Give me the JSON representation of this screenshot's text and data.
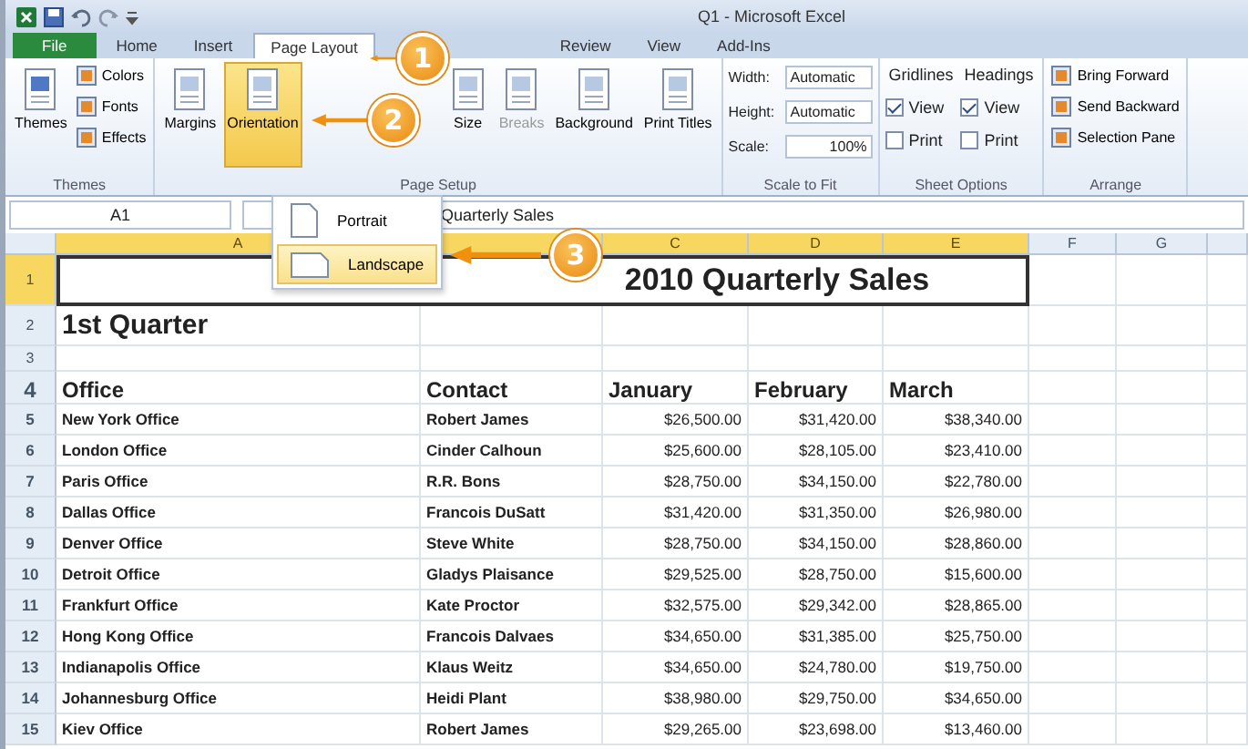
{
  "window": {
    "title": "Q1 - Microsoft Excel"
  },
  "tabs": [
    {
      "label": "File",
      "kind": "file",
      "selected": false
    },
    {
      "label": "Home",
      "kind": "tab",
      "selected": false
    },
    {
      "label": "Insert",
      "kind": "tab",
      "selected": false
    },
    {
      "label": "Page Layout",
      "kind": "tab",
      "selected": true
    },
    {
      "label": "Review",
      "kind": "tab",
      "selected": false
    },
    {
      "label": "View",
      "kind": "tab",
      "selected": false
    },
    {
      "label": "Add-Ins",
      "kind": "tab",
      "selected": false
    }
  ],
  "ribbon": {
    "groups": [
      {
        "label": "Themes",
        "columns": [
          [
            {
              "kind": "large",
              "label": "Themes",
              "selected": false,
              "disabled": false
            }
          ],
          [
            {
              "kind": "small",
              "label": "Colors"
            },
            {
              "kind": "small",
              "label": "Fonts"
            },
            {
              "kind": "small",
              "label": "Effects"
            }
          ]
        ]
      },
      {
        "label": "Page Setup",
        "columns": [
          [
            {
              "kind": "large",
              "label": "Margins",
              "selected": false,
              "disabled": false
            }
          ],
          [
            {
              "kind": "large",
              "label": "Orientation",
              "selected": true,
              "disabled": false
            }
          ],
          [
            {
              "kind": "large",
              "label": "Size",
              "selected": false,
              "disabled": false
            }
          ],
          [
            {
              "kind": "large",
              "label": "Breaks",
              "selected": false,
              "disabled": true
            }
          ],
          [
            {
              "kind": "large",
              "label": "Background",
              "selected": false,
              "disabled": false
            }
          ],
          [
            {
              "kind": "large",
              "label": "Print Titles",
              "selected": false,
              "disabled": false
            }
          ]
        ]
      },
      {
        "label": "Scale to Fit",
        "columns": [
          [
            {
              "kind": "dropdown",
              "label": "Width:",
              "value": "Automatic"
            },
            {
              "kind": "dropdown",
              "label": "Height:",
              "value": "Automatic"
            },
            {
              "kind": "spinner",
              "label": "Scale:",
              "value": "100%"
            }
          ]
        ]
      },
      {
        "label": "Sheet Options",
        "columns": [
          [
            {
              "kind": "heading",
              "label": "Gridlines"
            },
            {
              "kind": "check",
              "label": "View",
              "checked": true
            },
            {
              "kind": "check",
              "label": "Print",
              "checked": false
            }
          ],
          [
            {
              "kind": "heading",
              "label": "Headings"
            },
            {
              "kind": "check",
              "label": "View",
              "checked": true
            },
            {
              "kind": "check",
              "label": "Print",
              "checked": false
            }
          ]
        ]
      },
      {
        "label": "Arrange",
        "columns": [
          [
            {
              "kind": "small",
              "label": "Bring Forward"
            },
            {
              "kind": "small",
              "label": "Send Backward"
            },
            {
              "kind": "small",
              "label": "Selection Pane"
            }
          ]
        ]
      }
    ]
  },
  "orientation_menu": [
    {
      "label": "Portrait",
      "selected": false
    },
    {
      "label": "Landscape",
      "selected": true
    }
  ],
  "formula_bar": {
    "name_box": "A1",
    "formula": "Quarterly Sales"
  },
  "columns": [
    {
      "label": "A",
      "selected": true
    },
    {
      "selected": true
    },
    {
      "label": "C",
      "selected": true
    },
    {
      "label": "D",
      "selected": true
    },
    {
      "label": "E",
      "selected": true
    },
    {
      "label": "F",
      "selected": false
    },
    {
      "label": "G",
      "selected": false
    }
  ],
  "rows": [
    {
      "number": "1",
      "kind": "title",
      "selected": true,
      "cells": [
        "2010 Quarterly Sales"
      ]
    },
    {
      "number": "2",
      "kind": "subtitle",
      "selected": false,
      "cells": [
        "1st Quarter"
      ]
    },
    {
      "number": "3",
      "kind": "blank",
      "selected": false,
      "cells": []
    },
    {
      "number": "4",
      "kind": "header",
      "selected": false,
      "cells": [
        "Office",
        "Contact",
        "January",
        "February",
        "March"
      ]
    },
    {
      "number": "5",
      "kind": "data",
      "selected": false,
      "cells": [
        "New York Office",
        "Robert James",
        "$26,500.00",
        "$31,420.00",
        "$38,340.00"
      ]
    },
    {
      "number": "6",
      "kind": "data",
      "selected": false,
      "cells": [
        "London Office",
        "Cinder Calhoun",
        "$25,600.00",
        "$28,105.00",
        "$23,410.00"
      ]
    },
    {
      "number": "7",
      "kind": "data",
      "selected": false,
      "cells": [
        "Paris Office",
        "R.R. Bons",
        "$28,750.00",
        "$34,150.00",
        "$22,780.00"
      ]
    },
    {
      "number": "8",
      "kind": "data",
      "selected": false,
      "cells": [
        "Dallas Office",
        "Francois DuSatt",
        "$31,420.00",
        "$31,350.00",
        "$26,980.00"
      ]
    },
    {
      "number": "9",
      "kind": "data",
      "selected": false,
      "cells": [
        "Denver Office",
        "Steve White",
        "$28,750.00",
        "$34,150.00",
        "$28,860.00"
      ]
    },
    {
      "number": "10",
      "kind": "data",
      "selected": false,
      "cells": [
        "Detroit Office",
        "Gladys Plaisance",
        "$29,525.00",
        "$28,750.00",
        "$15,600.00"
      ]
    },
    {
      "number": "11",
      "kind": "data",
      "selected": false,
      "cells": [
        "Frankfurt Office",
        "Kate Proctor",
        "$32,575.00",
        "$29,342.00",
        "$28,865.00"
      ]
    },
    {
      "number": "12",
      "kind": "data",
      "selected": false,
      "cells": [
        "Hong Kong Office",
        "Francois Dalvaes",
        "$34,650.00",
        "$31,385.00",
        "$25,750.00"
      ]
    },
    {
      "number": "13",
      "kind": "data",
      "selected": false,
      "cells": [
        "Indianapolis Office",
        "Klaus Weitz",
        "$34,650.00",
        "$24,780.00",
        "$19,750.00"
      ]
    },
    {
      "number": "14",
      "kind": "data",
      "selected": false,
      "cells": [
        "Johannesburg Office",
        "Heidi Plant",
        "$38,980.00",
        "$29,750.00",
        "$34,650.00"
      ]
    },
    {
      "number": "15",
      "kind": "data",
      "selected": false,
      "cells": [
        "Kiev Office",
        "Robert James",
        "$29,265.00",
        "$23,698.00",
        "$13,460.00"
      ]
    }
  ],
  "callouts": [
    {
      "number": "1"
    },
    {
      "number": "2"
    },
    {
      "number": "3"
    }
  ]
}
